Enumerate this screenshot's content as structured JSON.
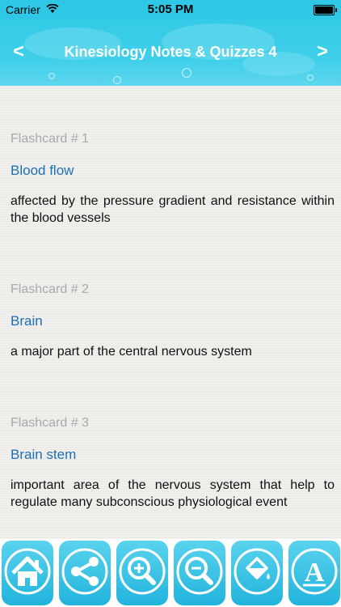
{
  "status_bar": {
    "carrier": "Carrier",
    "time": "5:05 PM"
  },
  "header": {
    "title": "Kinesiology Notes & Quizzes 4",
    "back_label": "<",
    "forward_label": ">",
    "background_color": "#34cbe8"
  },
  "flashcards": [
    {
      "label": "Flashcard # 1",
      "term": "Blood flow",
      "definition": "affected by the pressure gradient and resistance within the blood vessels"
    },
    {
      "label": "Flashcard # 2",
      "term": "Brain",
      "definition": "a major part of the central nervous system"
    },
    {
      "label": "Flashcard # 3",
      "term": "Brain stem",
      "definition": "important area of the nervous system that help to regulate many subconscious physiological event"
    }
  ],
  "toolbar": {
    "buttons": [
      {
        "icon": "home-icon"
      },
      {
        "icon": "share-icon"
      },
      {
        "icon": "zoom-in-icon"
      },
      {
        "icon": "zoom-out-icon"
      },
      {
        "icon": "paint-bucket-icon"
      },
      {
        "icon": "font-icon",
        "glyph": "A"
      }
    ],
    "accent_color": "#2ec0e4"
  }
}
